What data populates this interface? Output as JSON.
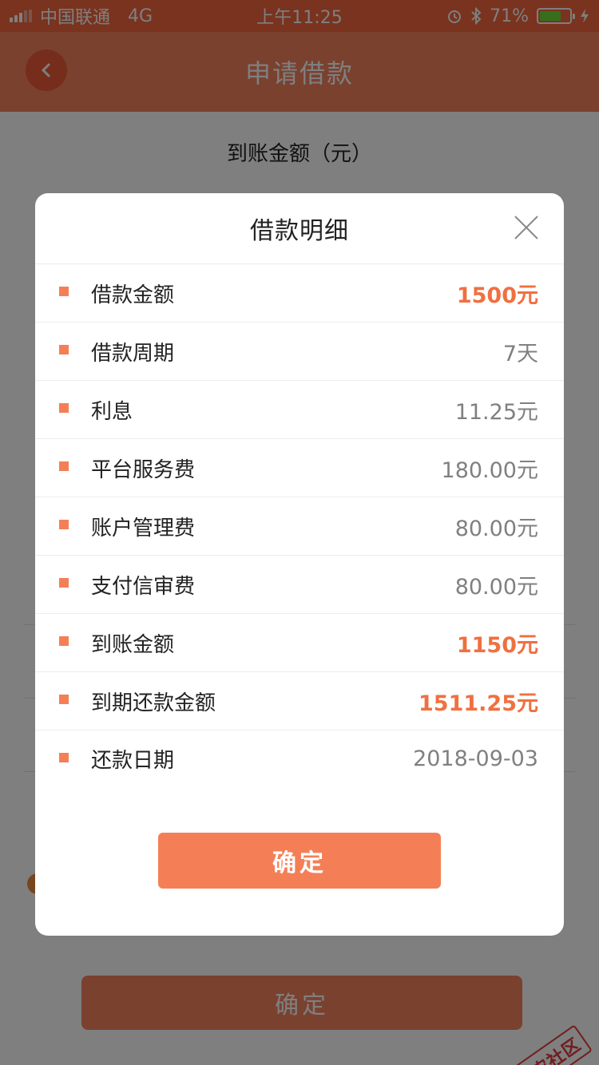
{
  "status_bar": {
    "carrier": "中国联通",
    "network": "4G",
    "time": "上午11:25",
    "battery_percent": "71%",
    "battery_level": 0.71
  },
  "nav": {
    "title": "申请借款",
    "back_icon": "chevron-left-icon"
  },
  "page": {
    "received_amount_label": "到账金额（元）",
    "confirm_label": "确定",
    "watermark": "卡农社区"
  },
  "modal": {
    "title": "借款明细",
    "close_icon": "close-icon",
    "rows": [
      {
        "label": "借款金额",
        "value": "1500元",
        "accent": true
      },
      {
        "label": "借款周期",
        "value": "7天",
        "accent": false
      },
      {
        "label": "利息",
        "value": "11.25元",
        "accent": false
      },
      {
        "label": "平台服务费",
        "value": "180.00元",
        "accent": false
      },
      {
        "label": "账户管理费",
        "value": "80.00元",
        "accent": false
      },
      {
        "label": "支付信审费",
        "value": "80.00元",
        "accent": false
      },
      {
        "label": "到账金额",
        "value": "1150元",
        "accent": true
      },
      {
        "label": "到期还款金额",
        "value": "1511.25元",
        "accent": true
      },
      {
        "label": "还款日期",
        "value": "2018-09-03",
        "accent": false
      }
    ],
    "confirm_label": "确定"
  },
  "colors": {
    "status_bar": "#f2663f",
    "nav_bar": "#f5825f",
    "accent": "#f07040",
    "button": "#f47f57"
  }
}
